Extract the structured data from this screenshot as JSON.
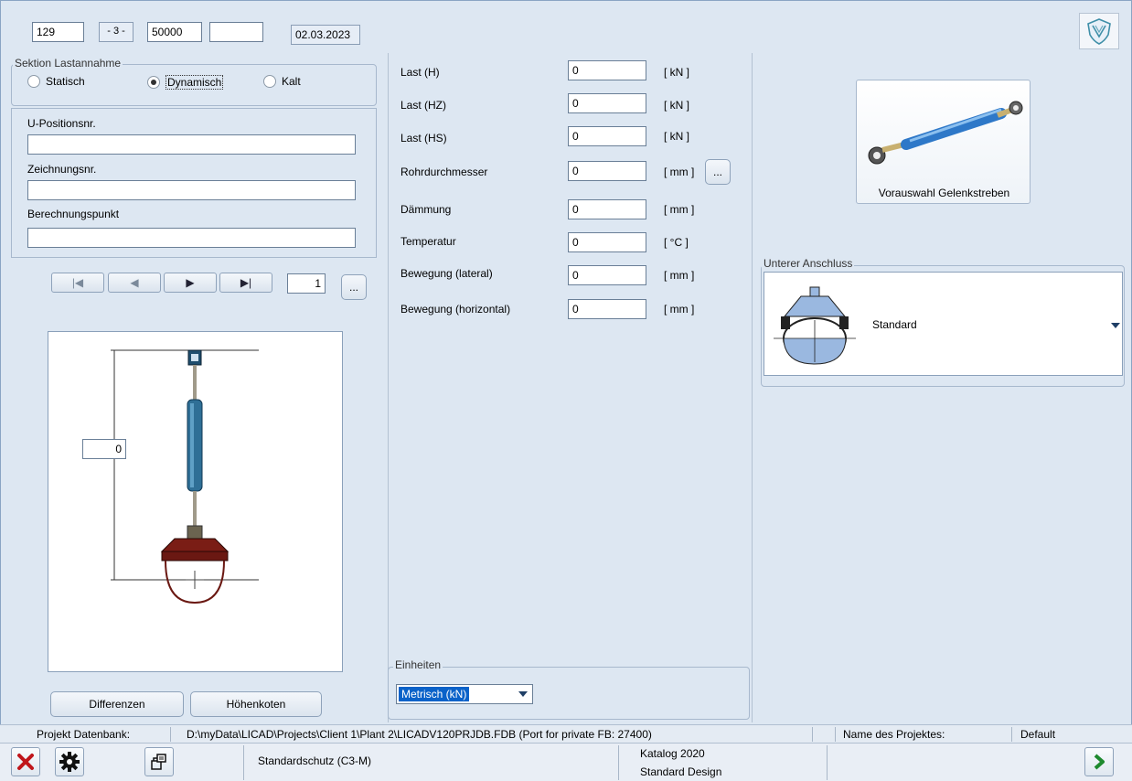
{
  "header": {
    "field1": "129",
    "separator": "- 3 -",
    "field2": "50000",
    "field3": "",
    "date": "02.03.2023"
  },
  "sektion": {
    "title": "Sektion Lastannahme",
    "options": [
      "Statisch",
      "Dynamisch",
      "Kalt"
    ],
    "selected": "Dynamisch"
  },
  "fields": {
    "u_position_label": "U-Positionsnr.",
    "u_position_value": "",
    "zeichnung_label": "Zeichnungsnr.",
    "zeichnung_value": "",
    "berechnung_label": "Berechnungspunkt",
    "berechnung_value": ""
  },
  "navigator": {
    "first": "|◀",
    "prev": "◀",
    "next": "▶",
    "last": "▶|",
    "page": "1",
    "more": "..."
  },
  "diagram": {
    "dimension_value": "0"
  },
  "loads": [
    {
      "label": "Last (H)",
      "value": "0",
      "unit": "[ kN ]"
    },
    {
      "label": "Last (HZ)",
      "value": "0",
      "unit": "[ kN ]"
    },
    {
      "label": "Last (HS)",
      "value": "0",
      "unit": "[ kN ]"
    },
    {
      "label": "Rohrdurchmesser",
      "value": "0",
      "unit": "[ mm ]"
    },
    {
      "label": "Dämmung",
      "value": "0",
      "unit": "[ mm ]"
    },
    {
      "label": "Temperatur",
      "value": "0",
      "unit": "[ °C ]"
    },
    {
      "label": "Bewegung (lateral)",
      "value": "0",
      "unit": "[ mm ]"
    },
    {
      "label": "Bewegung (horizontal)",
      "value": "0",
      "unit": "[ mm ]"
    }
  ],
  "rohr_more": "...",
  "einheiten": {
    "title": "Einheiten",
    "selected": "Metrisch (kN)"
  },
  "buttons": {
    "differenzen": "Differenzen",
    "hoehenkoten": "Höhenkoten",
    "vorauswahl": "Vorauswahl Gelenkstreben"
  },
  "unterer": {
    "title": "Unterer Anschluss",
    "selected": "Standard"
  },
  "status": {
    "db_label": "Projekt Datenbank:",
    "db_path": "D:\\myData\\LICAD\\Projects\\Client 1\\Plant 2\\LICADV120PRJDB.FDB (Port for private FB: 27400)",
    "name_label": "Name des Projektes:",
    "name_value": "Default"
  },
  "footer": {
    "standardschutz": "Standardschutz (C3-M)",
    "katalog": "Katalog 2020",
    "design": "Standard Design"
  },
  "colors": {
    "background": "#dde7f2",
    "accent_blue": "#1f5fa8",
    "close_red": "#c0161b",
    "go_green": "#1e8a2e"
  }
}
